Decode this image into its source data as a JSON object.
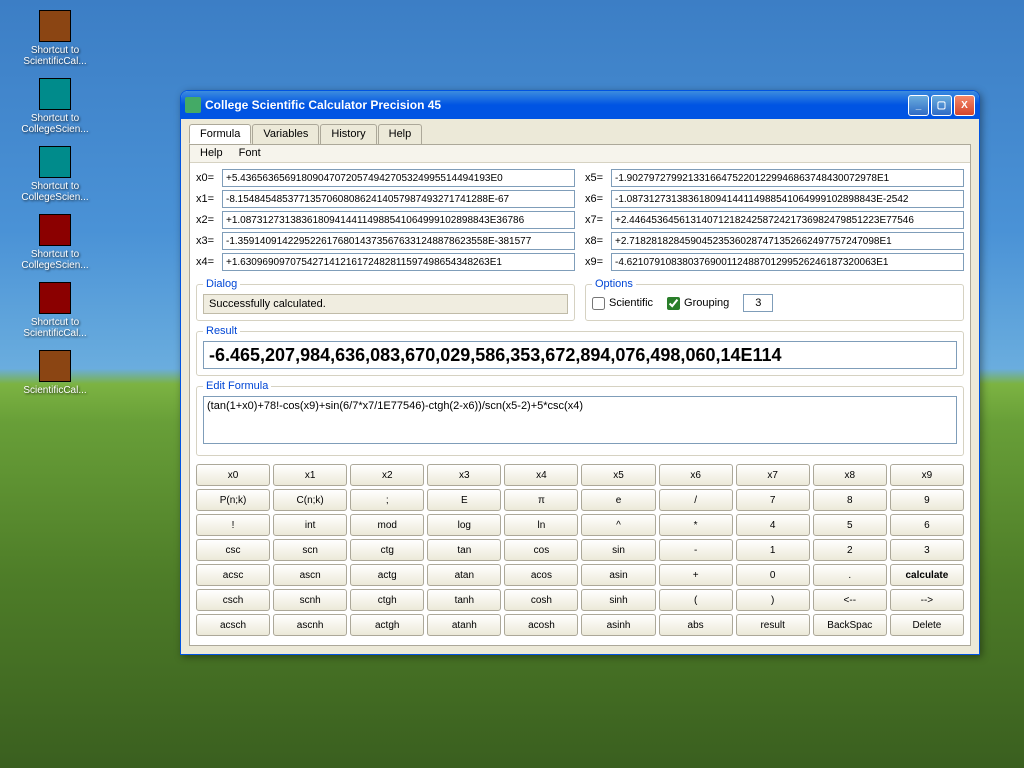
{
  "desktop_icons": [
    {
      "label": "Shortcut to ScientificCal...",
      "cls": ""
    },
    {
      "label": "Shortcut to CollegeScien...",
      "cls": "teal"
    },
    {
      "label": "Shortcut to CollegeScien...",
      "cls": "teal"
    },
    {
      "label": "Shortcut to CollegeScien...",
      "cls": "red"
    },
    {
      "label": "Shortcut to ScientificCal...",
      "cls": "red"
    },
    {
      "label": "ScientificCal...",
      "cls": ""
    }
  ],
  "window": {
    "title": "College Scientific Calculator Precision 45"
  },
  "tabs": [
    "Formula",
    "Variables",
    "History",
    "Help"
  ],
  "menu": [
    "Help",
    "Font"
  ],
  "vars_left": [
    {
      "lbl": "x0=",
      "val": "+5.436563656918090470720574942705324995514494193E0"
    },
    {
      "lbl": "x1=",
      "val": "-8.154845485377135706080862414057987493271741288E-67"
    },
    {
      "lbl": "x2=",
      "val": "+1.087312731383618094144114988541064999102898843E36786"
    },
    {
      "lbl": "x3=",
      "val": "-1.359140914229522617680143735676331248878623558E-381577"
    },
    {
      "lbl": "x4=",
      "val": "+1.630969097075427141216172482811597498654348263E1"
    }
  ],
  "vars_right": [
    {
      "lbl": "x5=",
      "val": "-1.902797279921331664752201229946863748430072978E1"
    },
    {
      "lbl": "x6=",
      "val": "-1.087312731383618094144114988541064999102898843E-2542"
    },
    {
      "lbl": "x7=",
      "val": "+2.446453645613140712182425872421736982479851223E77546"
    },
    {
      "lbl": "x8=",
      "val": "+2.718281828459045235360287471352662497757247098E1"
    },
    {
      "lbl": "x9=",
      "val": "-4.621079108380376900112488701299526246187320063E1"
    }
  ],
  "dialog": {
    "legend": "Dialog",
    "text": "Successfully calculated."
  },
  "options": {
    "legend": "Options",
    "scientific_label": "Scientific",
    "grouping_label": "Grouping",
    "grouping_value": "3"
  },
  "result": {
    "legend": "Result",
    "value": "-6.465,207,984,636,083,670,029,586,353,672,894,076,498,060,14E114"
  },
  "formula": {
    "legend": "Edit Formula",
    "value": "(tan(1+x0)+78!-cos(x9)+sin(6/7*x7/1E77546)-ctgh(2-x6))/scn(x5-2)+5*csc(x4)"
  },
  "keypad": [
    [
      "x0",
      "x1",
      "x2",
      "x3",
      "x4",
      "x5",
      "x6",
      "x7",
      "x8",
      "x9"
    ],
    [
      "P(n;k)",
      "C(n;k)",
      ";",
      "E",
      "π",
      "e",
      "/",
      "7",
      "8",
      "9"
    ],
    [
      "!",
      "int",
      "mod",
      "log",
      "ln",
      "^",
      "*",
      "4",
      "5",
      "6"
    ],
    [
      "csc",
      "scn",
      "ctg",
      "tan",
      "cos",
      "sin",
      "-",
      "1",
      "2",
      "3"
    ],
    [
      "acsc",
      "ascn",
      "actg",
      "atan",
      "acos",
      "asin",
      "+",
      "0",
      ".",
      "calculate"
    ],
    [
      "csch",
      "scnh",
      "ctgh",
      "tanh",
      "cosh",
      "sinh",
      "(",
      ")",
      "<--",
      "-->"
    ],
    [
      "acsch",
      "ascnh",
      "actgh",
      "atanh",
      "acosh",
      "asinh",
      "abs",
      "result",
      "BackSpac",
      "Delete"
    ]
  ]
}
